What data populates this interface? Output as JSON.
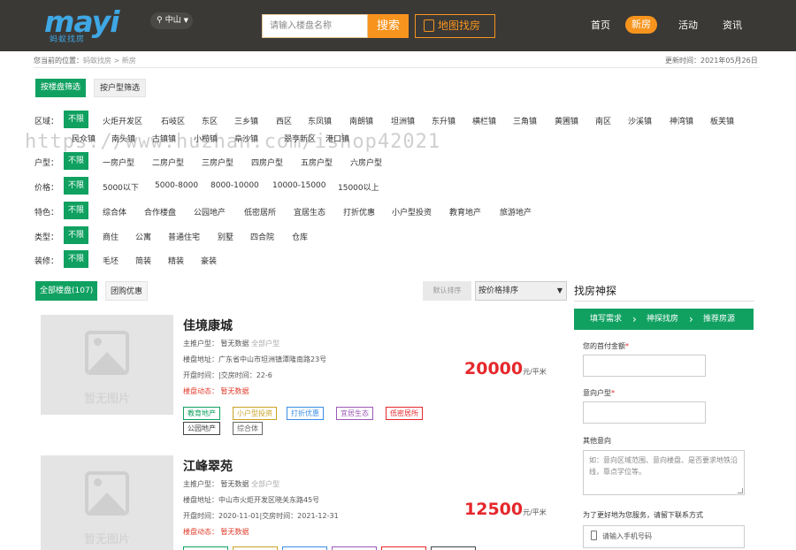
{
  "header": {
    "logo_text": "mayi",
    "logo_sub": "蚂蚁找房",
    "city": "中山",
    "search_placeholder": "请输入楼盘名称",
    "search_button": "搜索",
    "map_button": "地图找房",
    "nav": [
      "首页",
      "新房",
      "活动",
      "资讯"
    ],
    "nav_active": "新房"
  },
  "breadcrumb": {
    "prefix": "您当前的位置：",
    "home": "蚂蚁找房",
    "sep": " > ",
    "current": "新房"
  },
  "update_time": "更新时间：2021年05月26日",
  "filter_tabs": [
    "按楼盘筛选",
    "按户型筛选"
  ],
  "filters": {
    "area": {
      "label": "区域：",
      "none": "不限",
      "options": [
        "火炬开发区",
        "石岐区",
        "东区",
        "三乡镇",
        "西区",
        "东凤镇",
        "南朗镇",
        "坦洲镇",
        "东升镇",
        "横栏镇",
        "三角镇",
        "黄圃镇",
        "南区",
        "沙溪镇",
        "神湾镇",
        "板芙镇",
        "民众镇",
        "南头镇",
        "古镇镇",
        "小榄镇",
        "阜沙镇",
        "翠亨新区",
        "港口镇"
      ]
    },
    "layout": {
      "label": "户型：",
      "none": "不限",
      "options": [
        "一房户型",
        "二房户型",
        "三房户型",
        "四房户型",
        "五房户型",
        "六房户型"
      ]
    },
    "price": {
      "label": "价格：",
      "none": "不限",
      "options": [
        "5000以下",
        "5000-8000",
        "8000-10000",
        "10000-15000",
        "15000以上"
      ]
    },
    "feature": {
      "label": "特色：",
      "none": "不限",
      "options": [
        "综合体",
        "合作楼盘",
        "公园地产",
        "低密居所",
        "宜居生态",
        "打折优惠",
        "小户型投资",
        "教育地产",
        "旅游地产"
      ]
    },
    "type": {
      "label": "类型：",
      "none": "不限",
      "options": [
        "商住",
        "公寓",
        "普通住宅",
        "别墅",
        "四合院",
        "仓库"
      ]
    },
    "deco": {
      "label": "装修：",
      "none": "不限",
      "options": [
        "毛坯",
        "简装",
        "精装",
        "豪装"
      ]
    }
  },
  "list_tabs": [
    "全部楼盘(107)",
    "团购优惠"
  ],
  "sort": {
    "default": "默认排序",
    "select": "按价格排序"
  },
  "listings": [
    {
      "name": "佳境康城",
      "placeholder": "暂无图片",
      "main_type": "主推户型：  暂无数据",
      "all_types": "全部户型",
      "address": "楼盘地址：广东省中山市坦洲镇潭隆南路23号",
      "times": "开盘时间：|交房时间：22-6",
      "news": "楼盘动态：  暂无数据",
      "price": "20000",
      "unit": "元/平米",
      "tags": [
        "教育地产",
        "小户型投资",
        "打折优惠",
        "宜居生态",
        "低密居所",
        "公园地产",
        "综合体"
      ]
    },
    {
      "name": "江峰翠苑",
      "placeholder": "暂无图片",
      "main_type": "主推户型：  暂无数据",
      "all_types": "全部户型",
      "address": "楼盘地址：中山市火炬开发区晓关东路45号",
      "times": "开盘时间：2020-11-01|交房时间：2021-12-31",
      "news": "楼盘动态：  暂无数据",
      "price": "12500",
      "unit": "元/平米",
      "tags": []
    }
  ],
  "sidebar": {
    "title": "找房神探",
    "steps": [
      "填写需求",
      "神探找房",
      "推荐房源"
    ],
    "budget_label": "您的首付金额",
    "layout_label": "意向户型",
    "other_label": "其他意向",
    "other_placeholder": "如：意向区域范围、意向楼盘、是否要求地铁沿线，靠点学位等。",
    "note": "为了更好地为您服务，请留下联系方式",
    "phone_placeholder": "请输入手机号码"
  },
  "watermark": "https://www.huzhan.com/ishop42021",
  "colors": {
    "brand_green": "#10a161",
    "accent_orange": "#f7941d",
    "price_red": "#e5282c",
    "header_bg": "#3b3936"
  }
}
